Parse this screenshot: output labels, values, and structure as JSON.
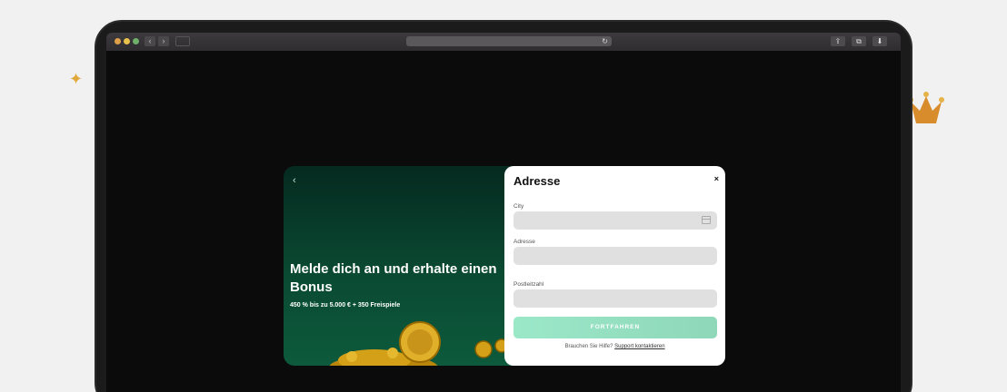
{
  "decor": {
    "sparkle_icon": "sparkle-icon",
    "crown_icon": "crown-icon"
  },
  "browser": {
    "icons": [
      "back-icon",
      "forward-icon",
      "sidebar-icon",
      "reload-icon",
      "share-icon",
      "tabs-icon",
      "download-icon"
    ]
  },
  "promo": {
    "back_icon": "‹",
    "title": "Melde dich an und erhalte einen Bonus",
    "subtitle": "450 % bis zu 5.000 € + 350 Freispiele"
  },
  "modal": {
    "title": "Adresse",
    "close": "×",
    "fields": [
      {
        "label": "City",
        "value": "",
        "placeholder": ""
      },
      {
        "label": "Adresse",
        "value": "",
        "placeholder": ""
      },
      {
        "label": "Postleitzahl",
        "value": "",
        "placeholder": ""
      }
    ],
    "continue_label": "FORTFAHREN",
    "help_text": "Brauchen Sie Hilfe?",
    "help_link": "Support kontaktieren"
  },
  "colors": {
    "promo_bg": "#0a4a33",
    "button_accent": "#9be8c9",
    "field_bg": "#e0e0e0"
  }
}
